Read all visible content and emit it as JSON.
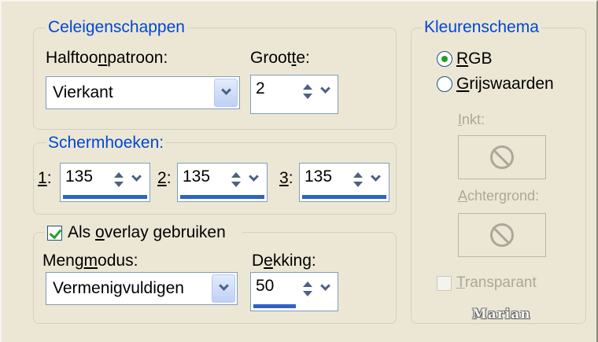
{
  "cell_properties": {
    "title": "Celeigenschappen",
    "halftone_label": [
      "Halftoo",
      "n",
      "patroon:"
    ],
    "size_label": [
      "Groot",
      "t",
      "e:"
    ],
    "halftone_value": "Vierkant",
    "size_value": "2"
  },
  "screen_angles": {
    "title": "Schermhoeken:",
    "fields": [
      {
        "key": "1",
        "suffix": ":",
        "value": "135",
        "fill": 1.0
      },
      {
        "key": "2",
        "suffix": ":",
        "value": "135",
        "fill": 1.0
      },
      {
        "key": "3",
        "suffix": ":",
        "value": "135",
        "fill": 1.0
      }
    ]
  },
  "overlay": {
    "checkbox_label": [
      "Als ",
      "o",
      "verlay gebruiken"
    ],
    "checked": true,
    "blend_label": [
      "Meng",
      "m",
      "odus:"
    ],
    "opacity_label": [
      "D",
      "e",
      "kking:"
    ],
    "blend_value": "Vermenigvuldigen",
    "opacity_value": "50",
    "opacity_fill": 0.5
  },
  "color_scheme": {
    "title": "Kleurenschema",
    "rgb_label": [
      "",
      "R",
      "GB"
    ],
    "gray_label": [
      "",
      "G",
      "rijswaarden"
    ],
    "rgb_selected": true,
    "ink_label": [
      "",
      "I",
      "nkt:"
    ],
    "background_label": [
      "",
      "A",
      "chtergrond:"
    ],
    "transparent_label": [
      "",
      "T",
      "ransparant"
    ],
    "transparent_checked": false
  },
  "signature": "Marian"
}
